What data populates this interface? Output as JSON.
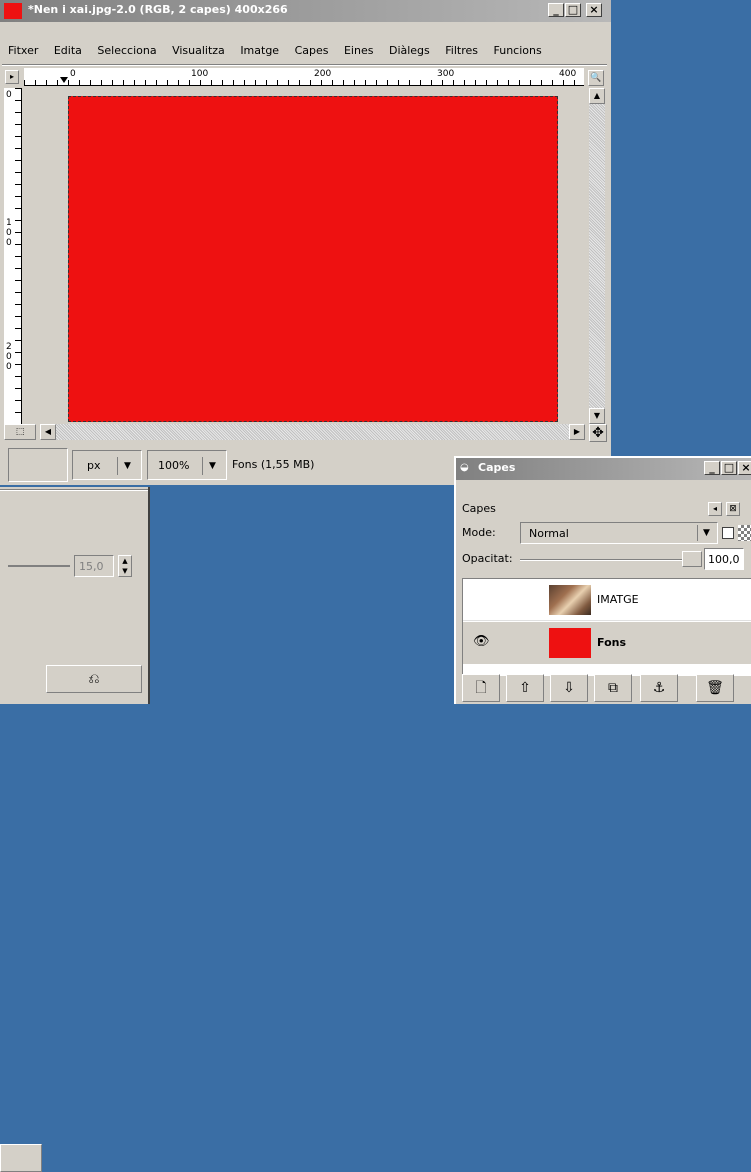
{
  "image_window": {
    "title": "*Nen i xai.jpg-2.0 (RGB, 2 capes) 400x266",
    "menu": [
      "Fitxer",
      "Edita",
      "Selecciona",
      "Visualitza",
      "Imatge",
      "Capes",
      "Eines",
      "Diàlegs",
      "Filtres",
      "Funcions"
    ],
    "ruler_h": [
      "0",
      "100",
      "200",
      "300",
      "400"
    ],
    "ruler_v": [
      "0",
      "1\n0\n0",
      "2\n0\n0"
    ],
    "canvas_color": "#ee1111",
    "status": {
      "unit": "px",
      "zoom": "100%",
      "info": "Fons (1,55 MB)"
    },
    "controls": {
      "minimize": "_",
      "maximize": "□",
      "close": "×"
    }
  },
  "left_panel": {
    "value": "15,0"
  },
  "layers_dialog": {
    "title": "Capes",
    "tab_label": "Capes",
    "mode_label": "Mode:",
    "mode_value": "Normal",
    "opacity_label": "Opacitat:",
    "opacity_value": "100,0",
    "layers": [
      {
        "name": "IMATGE",
        "visible": false,
        "selected": false
      },
      {
        "name": "Fons",
        "visible": true,
        "selected": true
      }
    ]
  }
}
